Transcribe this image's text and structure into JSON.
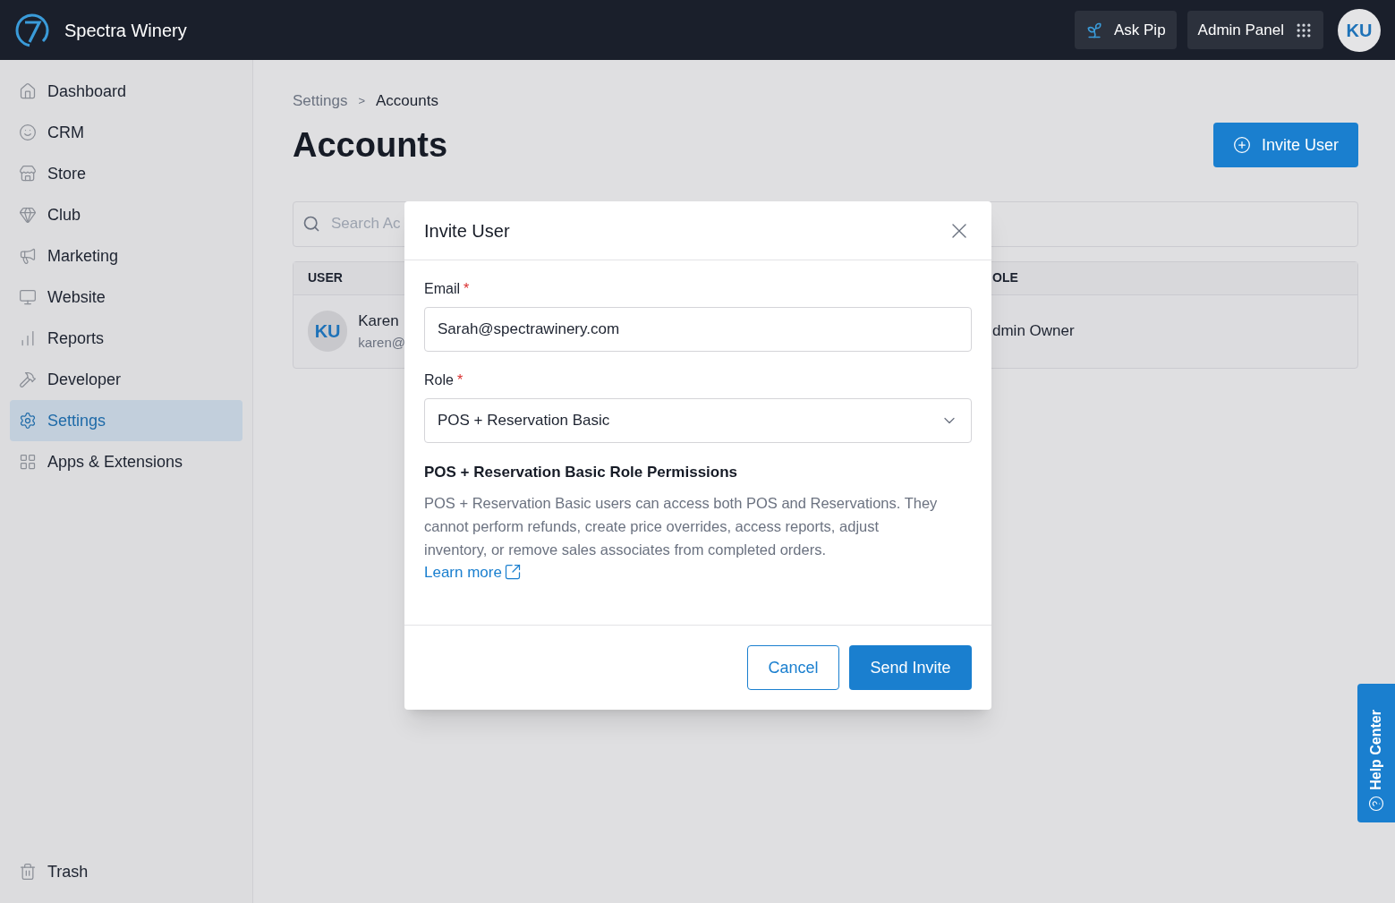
{
  "topbar": {
    "brand": "Spectra Winery",
    "ask_button": "Ask Pip",
    "admin_button": "Admin Panel",
    "avatar": "KU"
  },
  "sidebar": {
    "items": [
      {
        "label": "Dashboard",
        "selected": false
      },
      {
        "label": "CRM",
        "selected": false
      },
      {
        "label": "Store",
        "selected": false
      },
      {
        "label": "Club",
        "selected": false
      },
      {
        "label": "Marketing",
        "selected": false
      },
      {
        "label": "Website",
        "selected": false
      },
      {
        "label": "Reports",
        "selected": false
      },
      {
        "label": "Developer",
        "selected": false
      },
      {
        "label": "Settings",
        "selected": true
      },
      {
        "label": "Apps & Extensions",
        "selected": false
      }
    ],
    "footer": {
      "label": "Trash"
    }
  },
  "breadcrumb": [
    "Settings",
    "Accounts"
  ],
  "breadcrumb_separator": ">",
  "page_title": "Accounts",
  "invite_button": "Invite User",
  "search": {
    "placeholder": "Search Ac"
  },
  "table": {
    "columns": [
      "USER",
      "OLE"
    ],
    "rows": [
      {
        "avatar": "KU",
        "name": "Karen",
        "email": "karen@",
        "role": "dmin Owner"
      }
    ]
  },
  "dialog": {
    "title": "Invite User",
    "required_mark": "*",
    "fields": [
      {
        "kind": "text",
        "label": "Email",
        "required": true,
        "value": "Sarah@spectrawinery.com"
      },
      {
        "kind": "select",
        "label": "Role",
        "required": true,
        "value": "POS + Reservation Basic"
      }
    ],
    "permissions_title": "POS + Reservation Basic Role Permissions",
    "permissions_text": "POS + Reservation Basic users can access both POS and Reservations. They cannot perform refunds, create price overrides, access reports, adjust inventory, or remove sales associates from completed orders.",
    "link": "Learn more",
    "cancel": "Cancel",
    "submit": "Send Invite"
  },
  "help_tab": "Help Center"
}
